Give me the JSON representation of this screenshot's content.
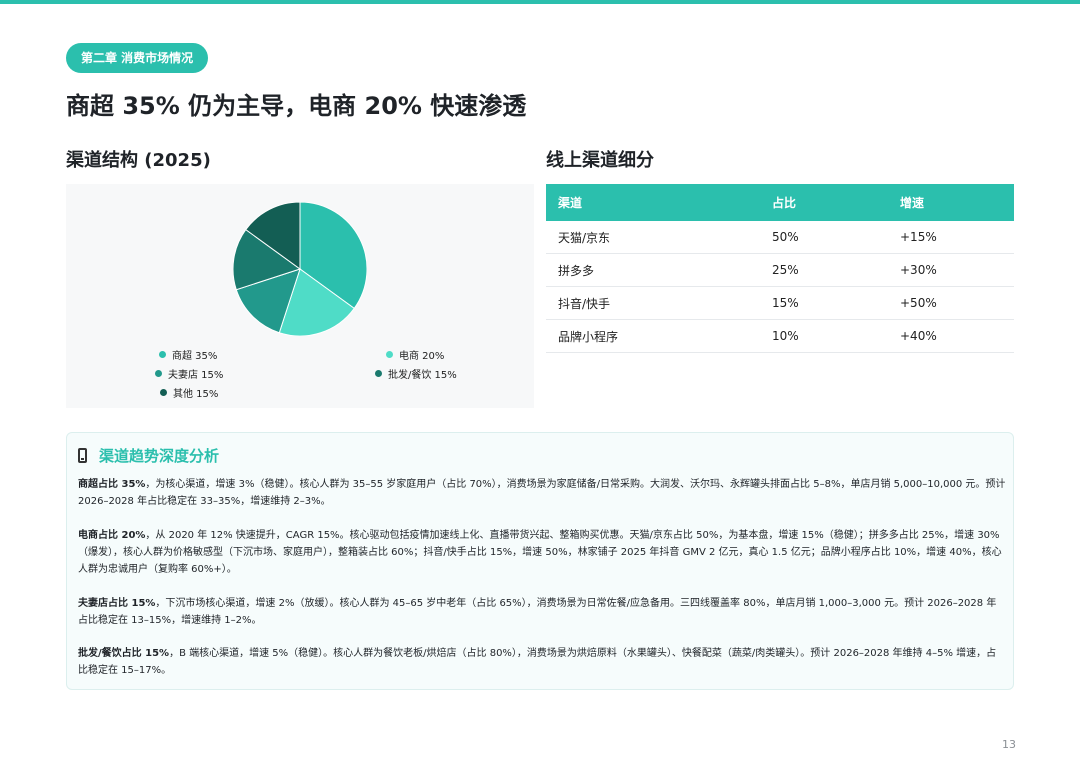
{
  "chapter_tag": "第二章 消费市场情况",
  "page_title": "商超 35% 仍为主导，电商 20% 快速渗透",
  "left_section_title": "渠道结构 (2025)",
  "right_section_title": "线上渠道细分",
  "chart_data": {
    "type": "pie",
    "title": "",
    "slices": [
      {
        "label": "商超 35%",
        "value": 35,
        "color": "#2bbfad"
      },
      {
        "label": "电商 20%",
        "value": 20,
        "color": "#4fdcc7"
      },
      {
        "label": "夫妻店 15%",
        "value": 15,
        "color": "#22998c"
      },
      {
        "label": "批发/餐饮 15%",
        "value": 15,
        "color": "#1a7a6e"
      },
      {
        "label": "其他 15%",
        "value": 15,
        "color": "#135e54"
      }
    ],
    "legend_position": "bottom"
  },
  "table": {
    "headers": [
      "渠道",
      "占比",
      "增速"
    ],
    "rows": [
      [
        "天猫/京东",
        "50%",
        "+15%"
      ],
      [
        "拼多多",
        "25%",
        "+30%"
      ],
      [
        "抖音/快手",
        "15%",
        "+50%"
      ],
      [
        "品牌小程序",
        "10%",
        "+40%"
      ]
    ]
  },
  "analysis": {
    "title": "渠道趋势深度分析",
    "paragraphs": [
      {
        "lead": "商超占比 35%",
        "text": "，为核心渠道，增速 3%（稳健）。核心人群为 35–55 岁家庭用户（占比 70%），消费场景为家庭储备/日常采购。大润发、沃尔玛、永辉罐头排面占比 5–8%，单店月销 5,000–10,000 元。预计 2026–2028 年占比稳定在 33–35%，增速维持 2–3%。"
      },
      {
        "lead": "电商占比 20%",
        "text": "，从 2020 年 12% 快速提升，CAGR 15%。核心驱动包括疫情加速线上化、直播带货兴起、整箱购买优惠。天猫/京东占比 50%，为基本盘，增速 15%（稳健）；拼多多占比 25%，增速 30%（爆发），核心人群为价格敏感型（下沉市场、家庭用户），整箱装占比 60%；抖音/快手占比 15%，增速 50%，林家铺子 2025 年抖音 GMV 2 亿元，真心 1.5 亿元；品牌小程序占比 10%，增速 40%，核心人群为忠诚用户（复购率 60%+）。"
      },
      {
        "lead": "夫妻店占比 15%",
        "text": "，下沉市场核心渠道，增速 2%（放缓）。核心人群为 45–65 岁中老年（占比 65%），消费场景为日常佐餐/应急备用。三四线覆盖率 80%，单店月销 1,000–3,000 元。预计 2026–2028 年占比稳定在 13–15%，增速维持 1–2%。"
      },
      {
        "lead": "批发/餐饮占比 15%",
        "text": "，B 端核心渠道，增速 5%（稳健）。核心人群为餐饮老板/烘焙店（占比 80%），消费场景为烘焙原料（水果罐头）、快餐配菜（蔬菜/肉类罐头）。预计 2026–2028 年维持 4–5% 增速，占比稳定在 15–17%。"
      }
    ]
  },
  "page_number": "13"
}
